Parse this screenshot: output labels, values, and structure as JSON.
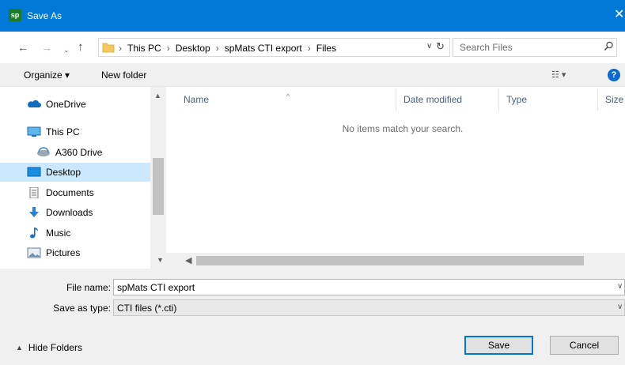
{
  "window": {
    "app_icon_text": "sp",
    "title": "Save As",
    "close_glyph": "✕"
  },
  "nav_buttons": {
    "back": "←",
    "forward": "→",
    "recent": "⌄",
    "up": "↑"
  },
  "address": {
    "crumbs": [
      "This PC",
      "Desktop",
      "spMats CTI export",
      "Files"
    ],
    "separator": "›"
  },
  "search": {
    "placeholder": "Search Files"
  },
  "toolbar": {
    "organize": "Organize ▾",
    "new_folder": "New folder",
    "view": "☷ ▾",
    "help": "?"
  },
  "nav_pane": {
    "items": [
      {
        "label": "OneDrive",
        "icon": "cloud-icon"
      },
      {
        "label": "This PC",
        "icon": "computer-icon"
      },
      {
        "label": "A360 Drive",
        "icon": "network-drive-icon"
      },
      {
        "label": "Desktop",
        "icon": "desktop-icon",
        "selected": true
      },
      {
        "label": "Documents",
        "icon": "documents-icon"
      },
      {
        "label": "Downloads",
        "icon": "downloads-icon"
      },
      {
        "label": "Music",
        "icon": "music-icon"
      },
      {
        "label": "Pictures",
        "icon": "pictures-icon"
      }
    ]
  },
  "file_list": {
    "columns": [
      "Name",
      "Date modified",
      "Type",
      "Size"
    ],
    "sort_glyph": "^",
    "empty_message": "No items match your search."
  },
  "form": {
    "file_name_label": "File name:",
    "file_name_value": "spMats CTI export",
    "save_type_label": "Save as type:",
    "save_type_value": "CTI files (*.cti)"
  },
  "footer": {
    "hide_folders": "Hide Folders",
    "save": "Save",
    "cancel": "Cancel"
  },
  "colors": {
    "titlebar": "#0078d7",
    "selection": "#cce8ff",
    "help": "#0a6ad1"
  }
}
